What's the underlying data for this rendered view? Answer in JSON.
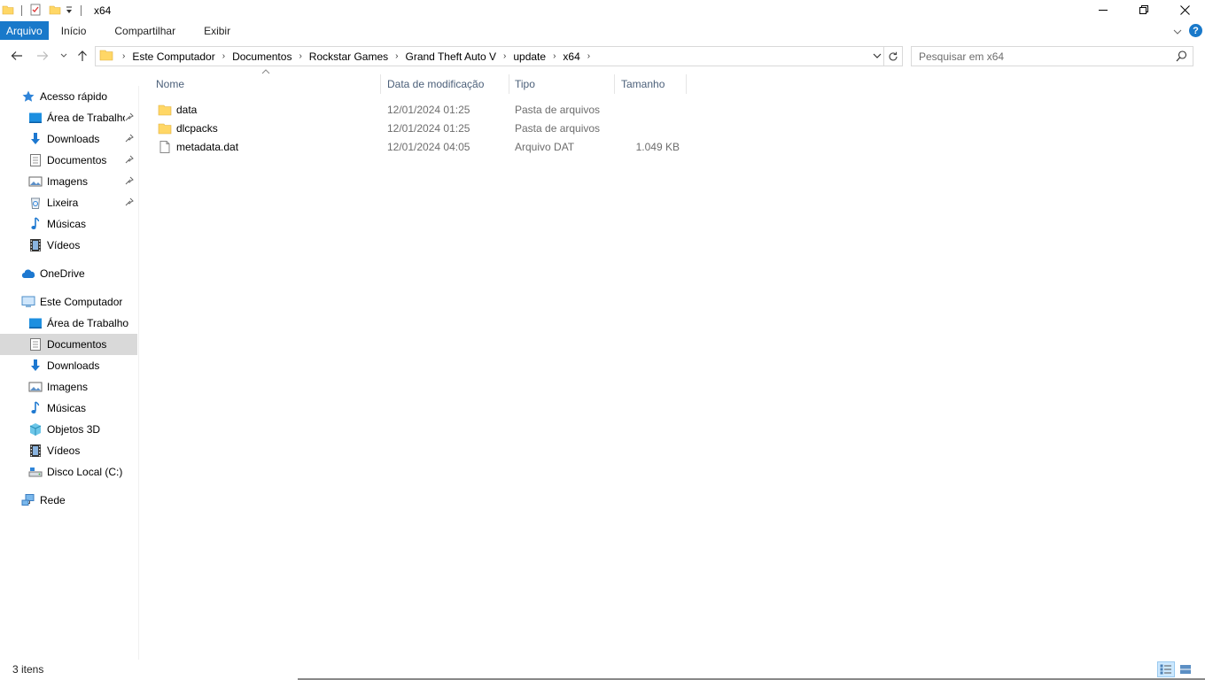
{
  "window": {
    "title": "x64"
  },
  "ribbon": {
    "tabs": [
      {
        "label": "Arquivo"
      },
      {
        "label": "Início"
      },
      {
        "label": "Compartilhar"
      },
      {
        "label": "Exibir"
      }
    ]
  },
  "address": {
    "crumbs": [
      "Este Computador",
      "Documentos",
      "Rockstar Games",
      "Grand Theft Auto V",
      "update",
      "x64"
    ]
  },
  "search": {
    "placeholder": "Pesquisar em x64"
  },
  "sidebar": {
    "quick_access": "Acesso rápido",
    "quick_items": [
      "Área de Trabalho",
      "Downloads",
      "Documentos",
      "Imagens",
      "Lixeira",
      "Músicas",
      "Vídeos"
    ],
    "onedrive": "OneDrive",
    "this_pc": "Este Computador",
    "pc_items": [
      "Área de Trabalho",
      "Documentos",
      "Downloads",
      "Imagens",
      "Músicas",
      "Objetos 3D",
      "Vídeos",
      "Disco Local (C:)"
    ],
    "network": "Rede"
  },
  "columns": {
    "name": "Nome",
    "date": "Data de modificação",
    "type": "Tipo",
    "size": "Tamanho"
  },
  "files": [
    {
      "name": "data",
      "date": "12/01/2024 01:25",
      "type": "Pasta de arquivos",
      "size": ""
    },
    {
      "name": "dlcpacks",
      "date": "12/01/2024 01:25",
      "type": "Pasta de arquivos",
      "size": ""
    },
    {
      "name": "metadata.dat",
      "date": "12/01/2024 04:05",
      "type": "Arquivo DAT",
      "size": "1.049 KB"
    }
  ],
  "status": {
    "count": "3 itens"
  },
  "colors": {
    "accent": "#1979ca",
    "folder": "#ffd766",
    "selected": "#d9d9d9"
  }
}
